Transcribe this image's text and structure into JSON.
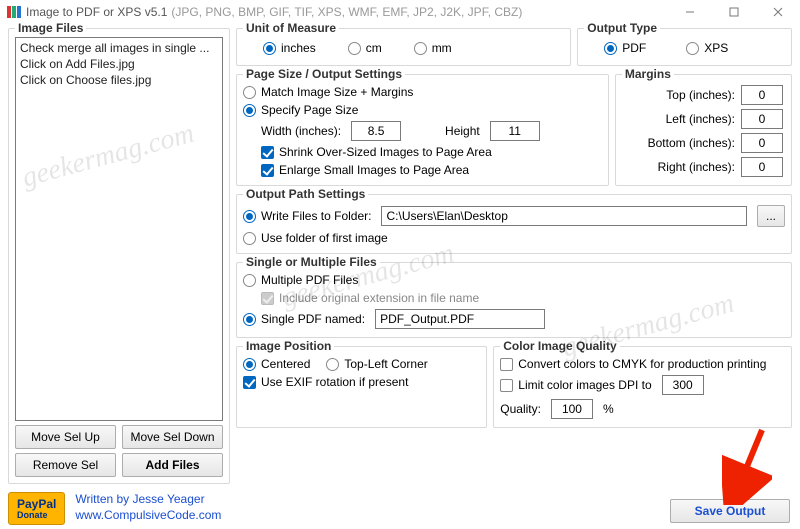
{
  "window": {
    "title": "Image to PDF or XPS  v5.1",
    "formats": "(JPG, PNG, BMP, GIF, TIF, XPS, WMF, EMF, JP2, J2K, JPF, CBZ)"
  },
  "image_files": {
    "legend": "Image Files",
    "items": [
      "Check merge all images in single ...",
      "Click on Add Files.jpg",
      "Click on Choose files.jpg"
    ],
    "move_up": "Move Sel Up",
    "move_down": "Move Sel Down",
    "remove": "Remove Sel",
    "add": "Add Files"
  },
  "unit": {
    "legend": "Unit of Measure",
    "options": {
      "inches": "inches",
      "cm": "cm",
      "mm": "mm"
    },
    "selected": "inches"
  },
  "output_type": {
    "legend": "Output Type",
    "options": {
      "pdf": "PDF",
      "xps": "XPS"
    },
    "selected": "pdf"
  },
  "page": {
    "legend": "Page Size / Output Settings",
    "match": "Match Image Size + Margins",
    "specify": "Specify Page Size",
    "width_label": "Width (inches):",
    "width_value": "8.5",
    "height_label": "Height",
    "height_value": "11",
    "shrink": "Shrink Over-Sized Images to Page Area",
    "enlarge": "Enlarge Small Images to Page Area"
  },
  "margins": {
    "legend": "Margins",
    "top": "Top (inches):",
    "left": "Left (inches):",
    "bottom": "Bottom (inches):",
    "right": "Right (inches):",
    "top_v": "0",
    "left_v": "0",
    "bottom_v": "0",
    "right_v": "0"
  },
  "output_path": {
    "legend": "Output Path Settings",
    "to_folder": "Write Files to Folder:",
    "folder_value": "C:\\Users\\Elan\\Desktop",
    "use_first": "Use folder of first image",
    "browse": "..."
  },
  "single_multiple": {
    "legend": "Single or Multiple Files",
    "multiple": "Multiple PDF Files",
    "include_ext": "Include original extension in file name",
    "single_named": "Single PDF named:",
    "single_value": "PDF_Output.PDF"
  },
  "image_position": {
    "legend": "Image Position",
    "centered": "Centered",
    "topleft": "Top-Left Corner",
    "exif": "Use EXIF rotation if present"
  },
  "color_quality": {
    "legend": "Color Image Quality",
    "cmyk": "Convert colors to CMYK for production printing",
    "limit_dpi": "Limit color images DPI to",
    "dpi_value": "300",
    "quality_label": "Quality:",
    "quality_value": "100",
    "percent": "%"
  },
  "footer": {
    "paypal": "PayPal",
    "donate": "Donate",
    "written": "Written by Jesse Yeager",
    "url": "www.CompulsiveCode.com"
  },
  "save_output": "Save Output",
  "watermark": "geekermag.com"
}
